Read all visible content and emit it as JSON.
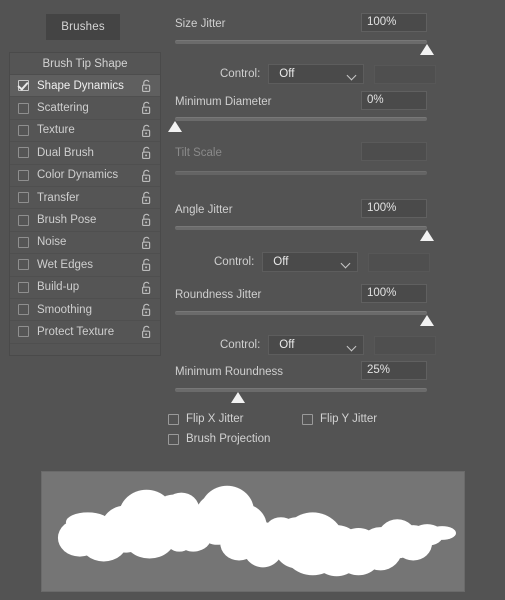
{
  "panel": {
    "tab_label": "Brushes",
    "sidebar_header": "Brush Tip Shape"
  },
  "sidebar": {
    "items": [
      {
        "label": "Shape Dynamics",
        "checked": true,
        "selected": true,
        "locked": false
      },
      {
        "label": "Scattering",
        "checked": false,
        "selected": false,
        "locked": false
      },
      {
        "label": "Texture",
        "checked": false,
        "selected": false,
        "locked": false
      },
      {
        "label": "Dual Brush",
        "checked": false,
        "selected": false,
        "locked": false
      },
      {
        "label": "Color Dynamics",
        "checked": false,
        "selected": false,
        "locked": false
      },
      {
        "label": "Transfer",
        "checked": false,
        "selected": false,
        "locked": false
      },
      {
        "label": "Brush Pose",
        "checked": false,
        "selected": false,
        "locked": false
      },
      {
        "label": "Noise",
        "checked": false,
        "selected": false,
        "locked": false
      },
      {
        "label": "Wet Edges",
        "checked": false,
        "selected": false,
        "locked": false
      },
      {
        "label": "Build-up",
        "checked": false,
        "selected": false,
        "locked": false
      },
      {
        "label": "Smoothing",
        "checked": false,
        "selected": false,
        "locked": false
      },
      {
        "label": "Protect Texture",
        "checked": false,
        "selected": false,
        "locked": false
      }
    ]
  },
  "settings": {
    "size_jitter": {
      "label": "Size Jitter",
      "value": "100%",
      "slider_percent": 100,
      "control_label": "Control:",
      "control_value": "Off"
    },
    "minimum_diameter": {
      "label": "Minimum Diameter",
      "value": "0%",
      "slider_percent": 0
    },
    "tilt_scale": {
      "label": "Tilt Scale",
      "value": "",
      "disabled": true
    },
    "angle_jitter": {
      "label": "Angle Jitter",
      "value": "100%",
      "slider_percent": 100,
      "control_label": "Control:",
      "control_value": "Off"
    },
    "roundness_jitter": {
      "label": "Roundness Jitter",
      "value": "100%",
      "slider_percent": 100,
      "control_label": "Control:",
      "control_value": "Off"
    },
    "minimum_roundness": {
      "label": "Minimum Roundness",
      "value": "25%",
      "slider_percent": 25
    }
  },
  "flip_options": {
    "flip_x": {
      "label": "Flip X Jitter",
      "checked": false
    },
    "flip_y": {
      "label": "Flip Y Jitter",
      "checked": false
    },
    "brush_projection": {
      "label": "Brush Projection",
      "checked": false
    }
  },
  "colors": {
    "panel_bg": "#535353",
    "sidebar_bg": "#555555",
    "selected_row": "#5f5f5f",
    "field_bg": "#4a4a4a",
    "text": "#cfcfcf",
    "slider_thumb": "#f2f2f2",
    "preview_bg": "#757575",
    "stroke": "#ffffff"
  }
}
